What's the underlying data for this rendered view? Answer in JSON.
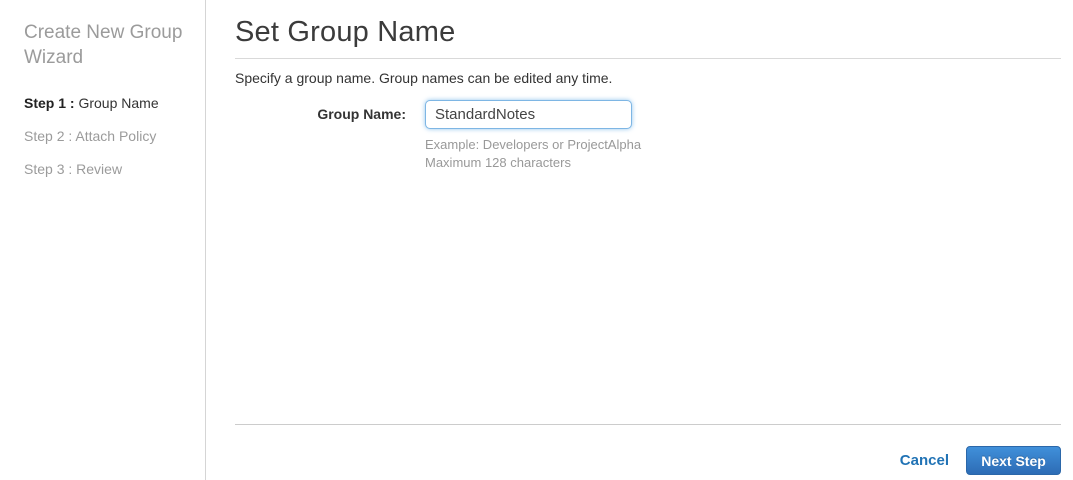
{
  "sidebar": {
    "title": "Create New Group Wizard",
    "steps": [
      {
        "prefix": "Step 1 :",
        "label": "Group Name"
      },
      {
        "prefix": "Step 2 :",
        "label": "Attach Policy"
      },
      {
        "prefix": "Step 3 :",
        "label": "Review"
      }
    ],
    "active_step_index": 1
  },
  "main": {
    "title": "Set Group Name",
    "description": "Specify a group name. Group names can be edited any time.",
    "form": {
      "group_name_label": "Group Name:",
      "group_name_value": "StandardNotes",
      "hint_example": "Example: Developers or ProjectAlpha",
      "hint_max": "Maximum 128 characters"
    },
    "footer": {
      "cancel_label": "Cancel",
      "next_label": "Next Step"
    }
  },
  "colors": {
    "button_blue_top": "#4090da",
    "button_blue_bottom": "#2d6cb5",
    "link_blue": "#2173b5",
    "focus_border_blue": "#7eb6e4",
    "muted_gray": "#9b9b9b",
    "text_dark": "#333333"
  }
}
